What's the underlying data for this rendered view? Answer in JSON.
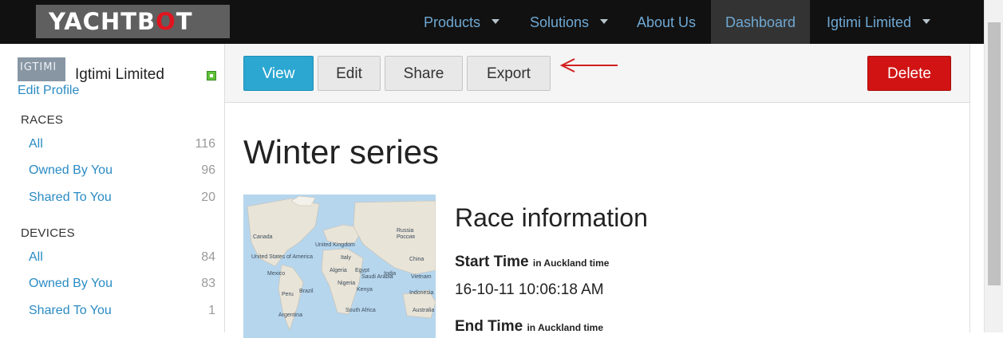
{
  "navbar": {
    "logo": {
      "yacht": "YACHTB",
      "o": "O",
      "t": "T"
    },
    "items": [
      {
        "label": "Products",
        "has_caret": true
      },
      {
        "label": "Solutions",
        "has_caret": true
      },
      {
        "label": "About Us",
        "has_caret": false
      },
      {
        "label": "Dashboard",
        "has_caret": false,
        "active": true
      },
      {
        "label": "Igtimi Limited",
        "has_caret": true
      }
    ]
  },
  "sidebar": {
    "org_logo_text": "IGTIMI",
    "org_name": "Igtimi Limited",
    "edit_profile": "Edit Profile",
    "races": {
      "title": "RACES",
      "items": [
        {
          "label": "All",
          "count": "116"
        },
        {
          "label": "Owned By You",
          "count": "96"
        },
        {
          "label": "Shared To You",
          "count": "20"
        }
      ]
    },
    "devices": {
      "title": "DEVICES",
      "items": [
        {
          "label": "All",
          "count": "84"
        },
        {
          "label": "Owned By You",
          "count": "83"
        },
        {
          "label": "Shared To You",
          "count": "1"
        }
      ]
    }
  },
  "toolbar": {
    "view": "View",
    "edit": "Edit",
    "share": "Share",
    "export": "Export",
    "delete": "Delete"
  },
  "main": {
    "title": "Winter series",
    "race_info_heading": "Race information",
    "start_time_label": "Start Time",
    "start_time_tz": "in Auckland time",
    "start_time_value": "16-10-11 10:06:18 AM",
    "end_time_label": "End Time",
    "end_time_tz": "in Auckland time"
  },
  "map_labels": [
    "Canada",
    "United States of America",
    "Mexico",
    "Peru",
    "Brazil",
    "Argentina",
    "United Kingdom",
    "Italy",
    "Algeria",
    "Egypt",
    "Saudi Arabia",
    "Nigeria",
    "Kenya",
    "South Africa",
    "India",
    "China",
    "Vietnam",
    "Indonesia",
    "Australia",
    "Russia",
    "Россия"
  ],
  "colors": {
    "accent": "#2ba7d1",
    "danger": "#d11313",
    "link": "#2a8bc4",
    "navbar": "#111111",
    "annotation_arrow": "#d32020"
  }
}
